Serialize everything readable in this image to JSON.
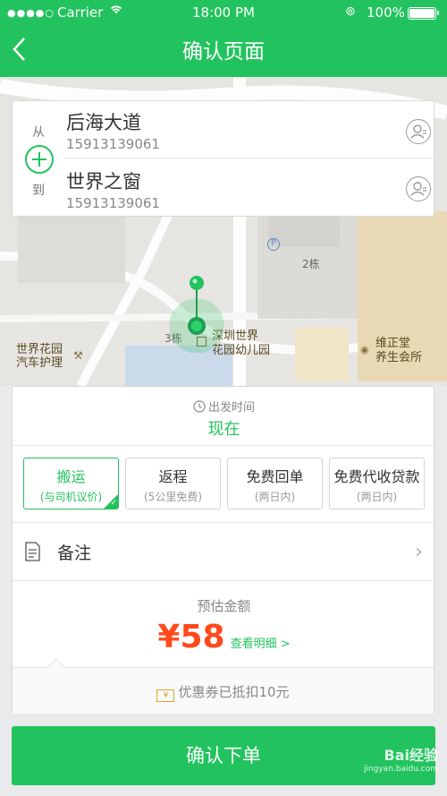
{
  "status_bar": {
    "carrier": "Carrier",
    "time": "18:00 PM",
    "battery": "100%"
  },
  "header": {
    "title": "确认页面"
  },
  "map": {
    "labels": {
      "building_2": "2栋",
      "building_3": "3栋",
      "poi_kindergarten_line1": "深圳世界",
      "poi_kindergarten_line2": "花园幼儿园",
      "poi_garden_line1": "世界花园",
      "poi_garden_line2": "汽车护理",
      "poi_club_line1": "维正堂",
      "poi_club_line2": "养生会所",
      "parking": "P"
    }
  },
  "route": {
    "from_label": "从",
    "to_label": "到",
    "origin": {
      "name": "后海大道",
      "phone": "15913139061"
    },
    "destination": {
      "name": "世界之窗",
      "phone": "15913139061"
    }
  },
  "order": {
    "depart_label": "出发时间",
    "depart_value": "现在",
    "services": [
      {
        "title": "搬运",
        "subtitle": "(与司机议价)",
        "selected": true
      },
      {
        "title": "返程",
        "subtitle": "(5公里免费)",
        "selected": false
      },
      {
        "title": "免费回单",
        "subtitle": "(两日内)",
        "selected": false
      },
      {
        "title": "免费代收贷款",
        "subtitle": "(两日内)",
        "selected": false
      }
    ],
    "remark_label": "备注",
    "estimate_label": "预估金额",
    "price": "¥58",
    "detail_link": "查看明细 >",
    "coupon_icon": "¥",
    "coupon_text": "优惠券已抵扣10元"
  },
  "confirm_button": "确认下单",
  "watermark": {
    "brand": "Bai经验",
    "url": "jingyan.baidu.com"
  },
  "colors": {
    "brand_green": "#22c35e",
    "price_red": "#ff4a1d"
  }
}
